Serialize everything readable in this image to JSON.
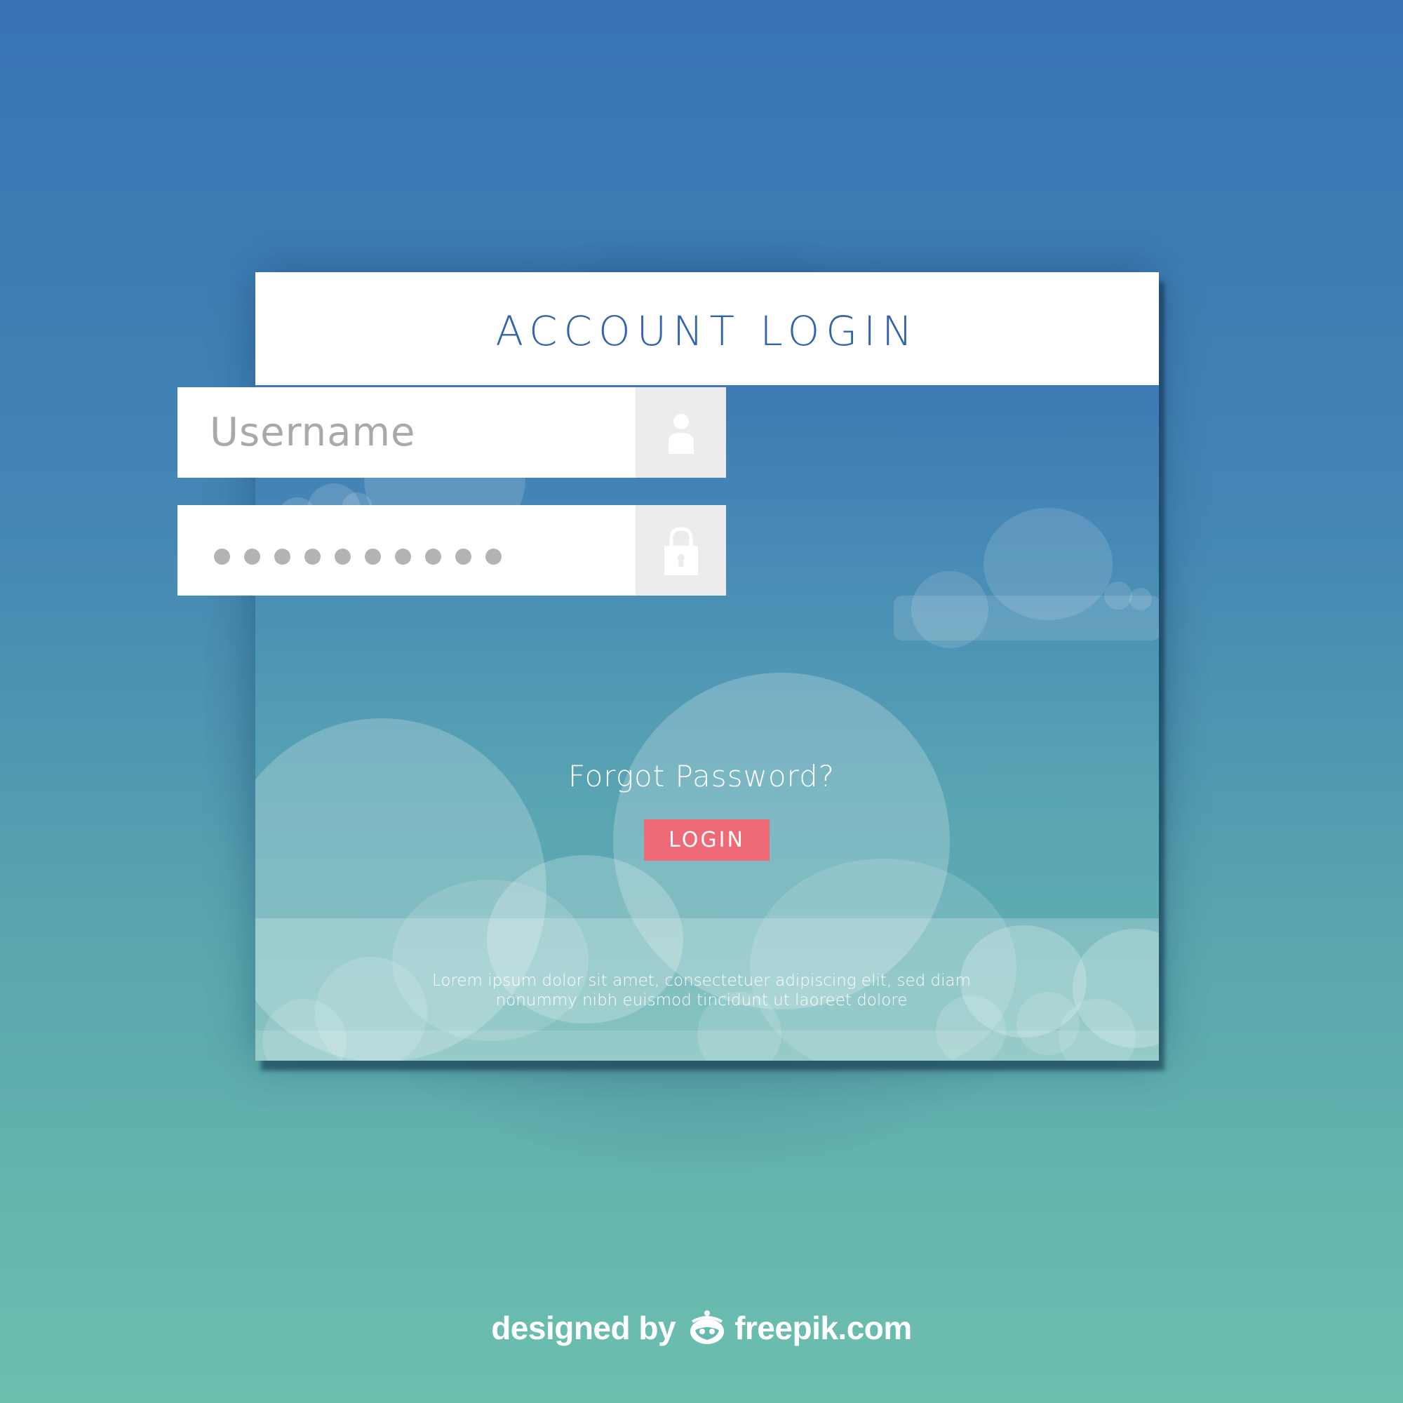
{
  "header": {
    "title": "ACCOUNT LOGIN"
  },
  "form": {
    "username_placeholder": "Username",
    "password_masked_length": 10,
    "forgot_password_label": "Forgot Password?",
    "login_button_label": "LOGIN"
  },
  "footer_text": {
    "line1": "Lorem ipsum dolor sit amet, consectetuer adipiscing elit, sed diam",
    "line2": "nonummy nibh euismod tincidunt ut laoreet dolore"
  },
  "credit": {
    "prefix": "designed by",
    "brand": "freepik.com"
  },
  "icons": {
    "username": "user-icon",
    "password": "lock-icon",
    "brand_logo": "freepik-logo-icon"
  },
  "colors": {
    "title": "#3164ad",
    "login_button": "#ef6a77",
    "field_icon_box": "#ececec",
    "placeholder_text": "#a9a9a9"
  }
}
